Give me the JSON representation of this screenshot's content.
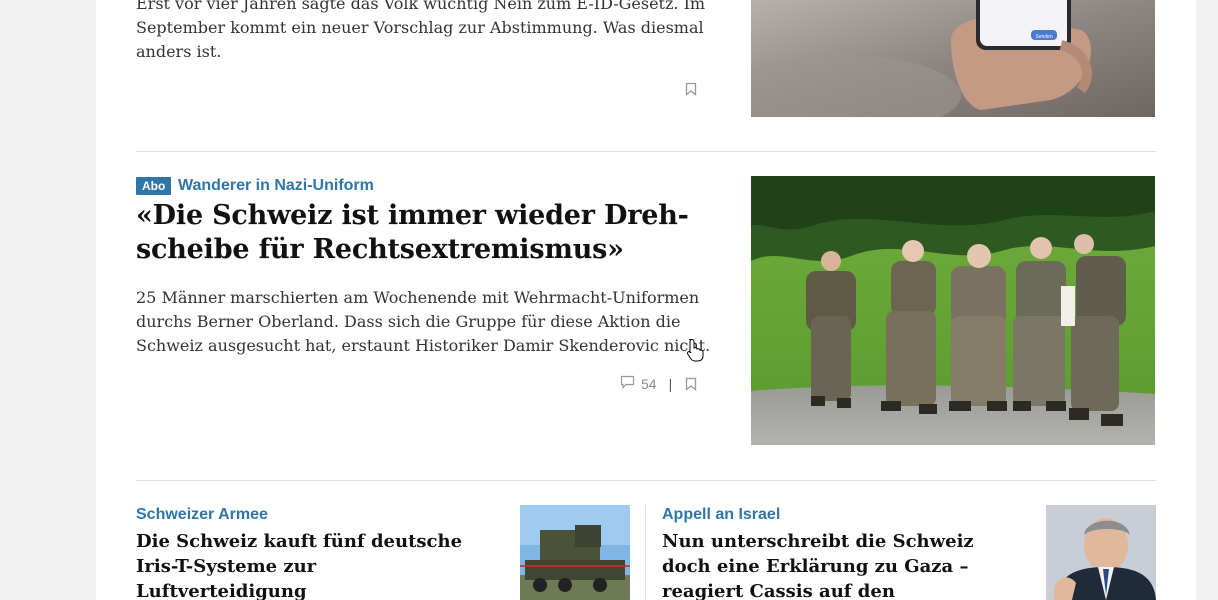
{
  "article_top": {
    "teaser": "Erst vor vier Jahren sagte das Volk wuchtig Nein zum E-ID-Gesetz. Im September kommt ein neuer Vorschlag zur Abstimmung. Was diesmal anders ist.",
    "image_icon": "phone-in-hand-photo",
    "phone_button_label": "Senden"
  },
  "article_featured": {
    "badge": "Abo",
    "kicker": "Wanderer in Nazi-Uniform",
    "title": "«Die Schweiz ist immer wieder Dreh­scheibe für Rechtsextremismus»",
    "teaser": "25 Männer marschierten am Wochenende mit Wehrmacht-Uniformen durchs Berner Oberland. Dass sich die Gruppe für diese Aktion die Schweiz ausgesucht hat, erstaunt Historiker Damir Skenderovic nicht.",
    "comment_count": "54",
    "meta_separator": "|",
    "image_icon": "marching-group-photo"
  },
  "article_left": {
    "kicker": "Schweizer Armee",
    "title": "Die Schweiz kauft fünf deutsche Iris-T-Systeme zur Luftverteidigung",
    "image_icon": "air-defense-vehicle-photo"
  },
  "article_right": {
    "kicker": "Appell an Israel",
    "title": "Nun unterschreibt die Schweiz doch eine Erklärung zu Gaza – reagiert Cassis auf den öffentlichen Druck?",
    "image_icon": "politician-portrait-photo"
  },
  "colors": {
    "accent": "#2f76a8",
    "text": "#111111",
    "muted": "#888888"
  }
}
